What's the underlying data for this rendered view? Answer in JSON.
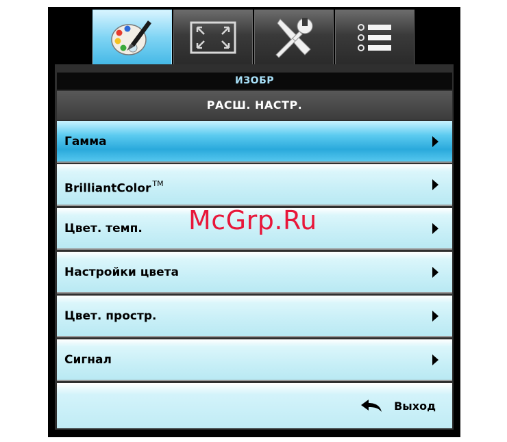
{
  "tabs": [
    {
      "icon": "palette-icon",
      "active": true
    },
    {
      "icon": "display-resize-icon",
      "active": false
    },
    {
      "icon": "tools-icon",
      "active": false
    },
    {
      "icon": "list-icon",
      "active": false
    }
  ],
  "menu": {
    "category": "ИЗОБР",
    "title": "РАСШ. НАСТР.",
    "items": [
      {
        "label": "Гамма"
      },
      {
        "label": "BrilliantColor",
        "suffix": "TM"
      },
      {
        "label": "Цвет. темп."
      },
      {
        "label": "Настройки цвета"
      },
      {
        "label": "Цвет. простр."
      },
      {
        "label": "Сигнал"
      }
    ],
    "exit_label": "Выход"
  },
  "watermark": "McGrp.Ru",
  "colors": {
    "accent": "#2aa9dc",
    "item_bg": "#c8eff7",
    "watermark": "#e8173a"
  }
}
